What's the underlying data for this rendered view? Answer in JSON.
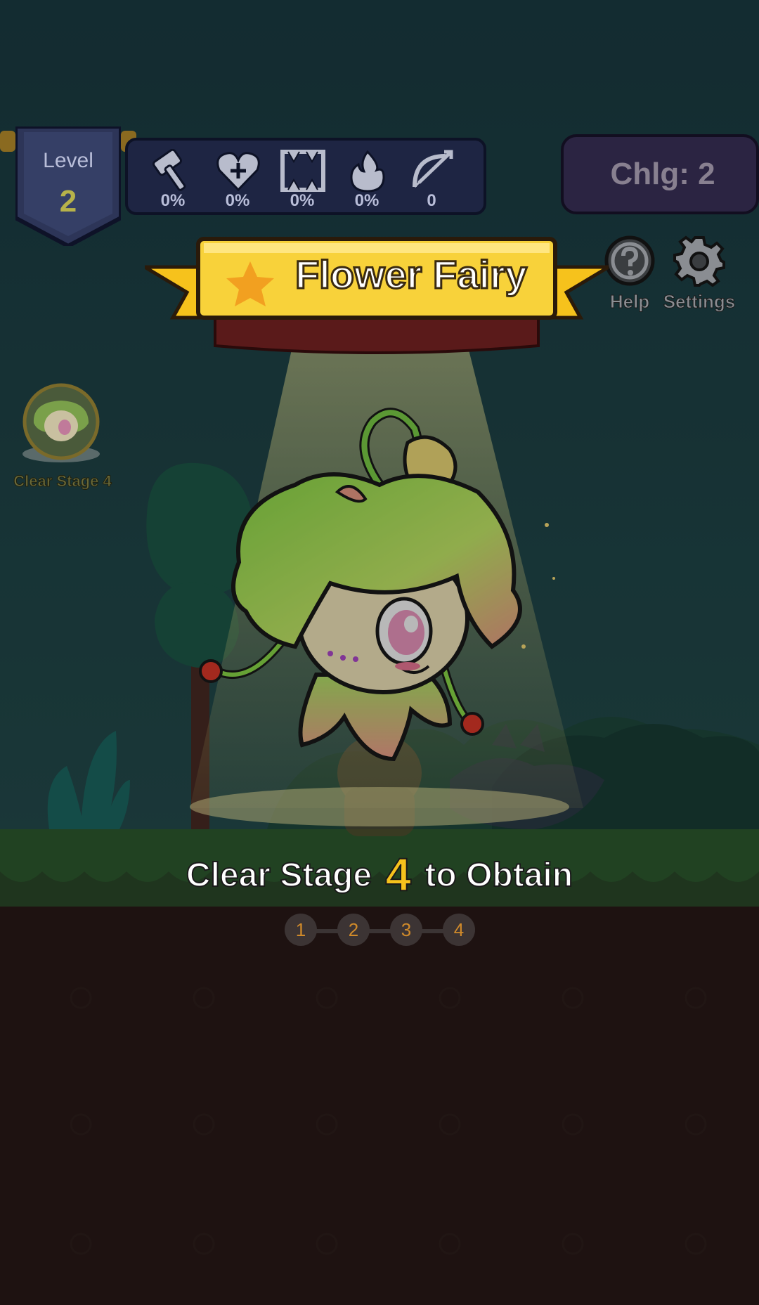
{
  "hud": {
    "level_label": "Level",
    "level_value": "2",
    "stats": [
      {
        "icon": "hammer-icon",
        "value": "0%"
      },
      {
        "icon": "heart-plus-icon",
        "value": "0%"
      },
      {
        "icon": "fang-icon",
        "value": "0%"
      },
      {
        "icon": "flame-icon",
        "value": "0%"
      },
      {
        "icon": "bow-icon",
        "value": "0"
      }
    ],
    "challenge": "Chlg: 2",
    "help_label": "Help",
    "settings_label": "Settings"
  },
  "unlock": {
    "title": "Flower Fairy",
    "side_label": "Clear Stage 4",
    "caption_before": "Clear Stage",
    "caption_stage": "4",
    "caption_after": "to Obtain",
    "stages": [
      "1",
      "2",
      "3",
      "4"
    ]
  },
  "colors": {
    "sky": "#1c3f45",
    "ground": "#2b1a18",
    "grass": "#2e5a2e",
    "ribbon": "#f6c21c",
    "accent_number": "#f6c21c"
  }
}
